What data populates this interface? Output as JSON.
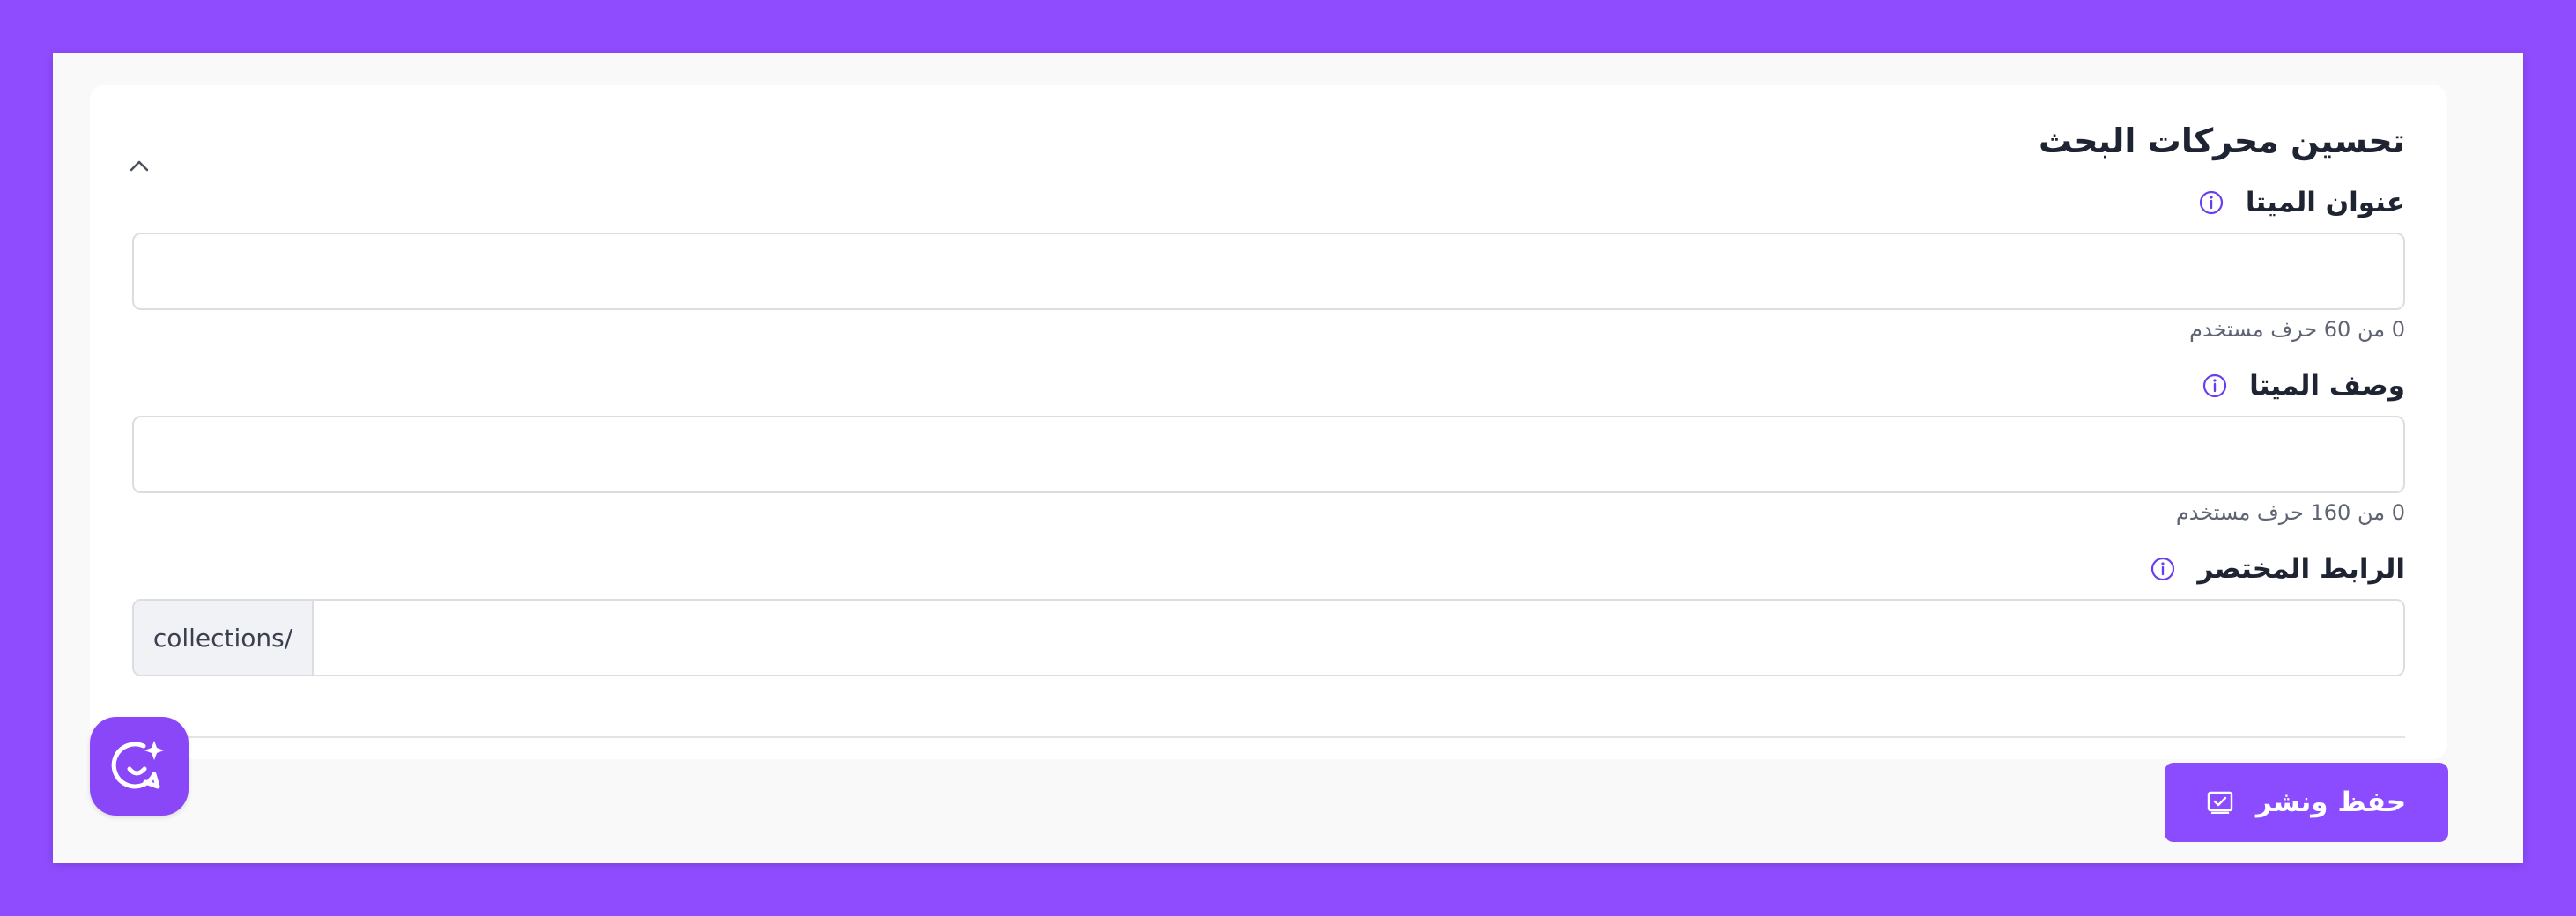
{
  "seo_section": {
    "title": "تحسين محركات البحث",
    "collapse_icon": "chevron-up-icon"
  },
  "meta_title": {
    "label": "عنوان الميتا",
    "info_icon": "info-circle-icon",
    "value": "",
    "counter": "0 من 60 حرف مستخدم"
  },
  "meta_description": {
    "label": "وصف الميتا",
    "info_icon": "info-circle-icon",
    "value": "",
    "counter": "0 من 160 حرف مستخدم"
  },
  "slug": {
    "label": "الرابط المختصر",
    "info_icon": "info-circle-icon",
    "prefix": "/collections",
    "value": ""
  },
  "assistant_button": {
    "icon": "ai-chat-sparkle-icon"
  },
  "save_button": {
    "label": "حفظ ونشر",
    "icon": "save-check-icon"
  },
  "colors": {
    "background": "#8f4cff",
    "accent": "#8b4bff",
    "info_icon": "#6a3df0",
    "title_text": "#1f2433"
  }
}
